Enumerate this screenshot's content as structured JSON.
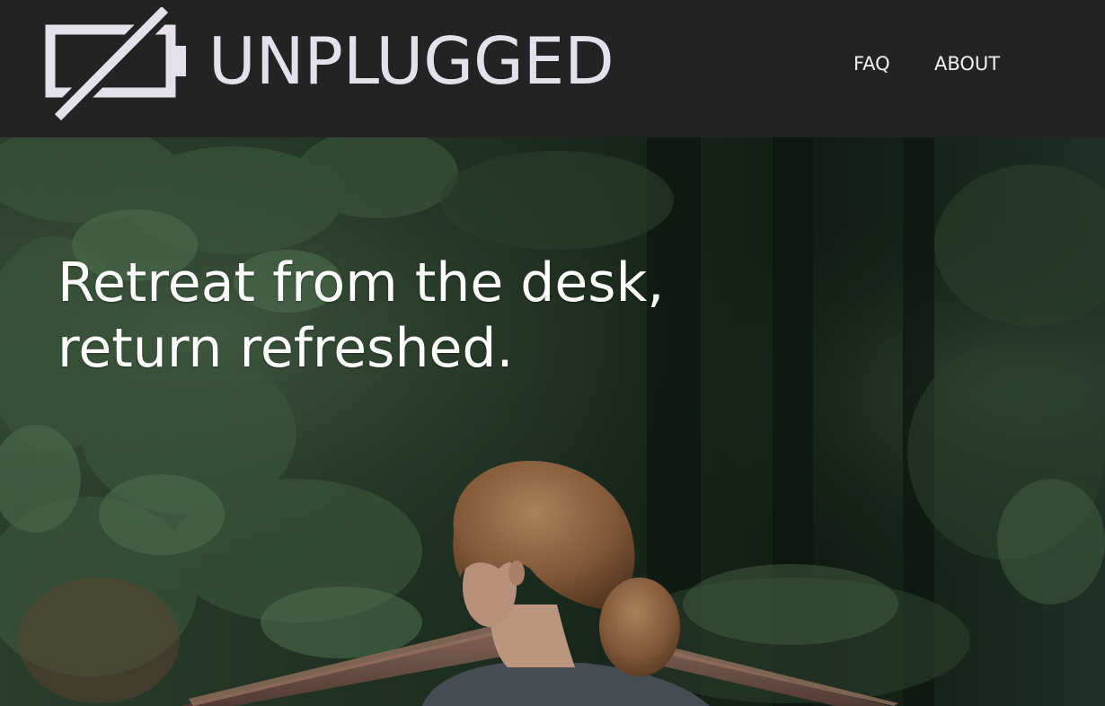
{
  "brand": {
    "name": "UNPLUGGED",
    "icon": "battery-off-icon",
    "color": "#e4e1ea"
  },
  "nav": {
    "items": [
      {
        "label": "FAQ"
      },
      {
        "label": "ABOUT"
      }
    ]
  },
  "hero": {
    "headline_line1": "Retreat from the desk,",
    "headline_line2": "return refreshed."
  },
  "colors": {
    "header_bg": "#232323",
    "nav_text": "#f2f2f2",
    "headline_text": "#ffffff"
  }
}
